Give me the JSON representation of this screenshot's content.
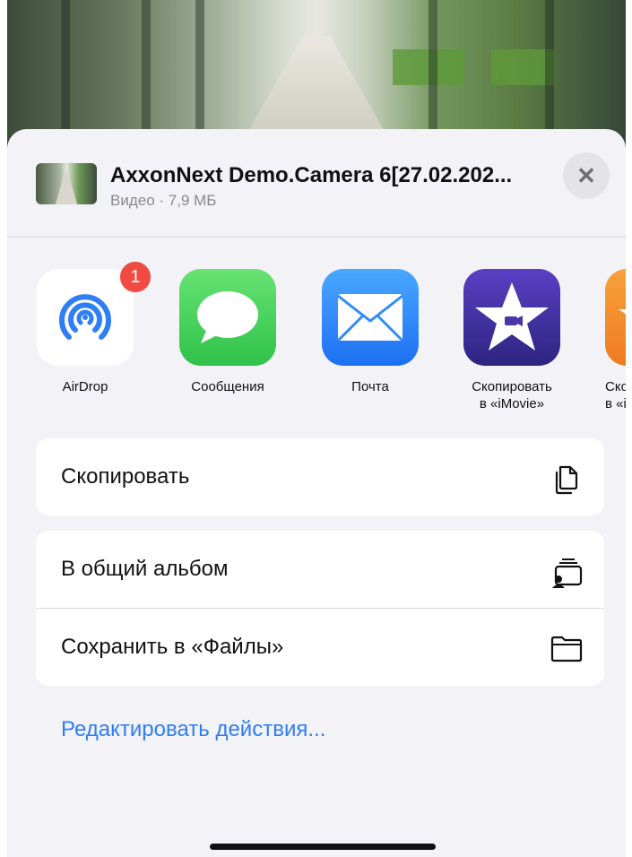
{
  "sheet": {
    "title": "AxxonNext Demo.Camera 6[27.02.202...",
    "subtitle": "Видео · 7,9 МБ"
  },
  "apps": [
    {
      "name": "AirDrop",
      "label1": "AirDrop",
      "label2": "",
      "badge": "1",
      "color": "#2f7ef6"
    },
    {
      "name": "messages",
      "label1": "Сообщения",
      "label2": "",
      "color": "#4cd964"
    },
    {
      "name": "mail",
      "label1": "Почта",
      "label2": "",
      "color": "#2f8cf6"
    },
    {
      "name": "imovie",
      "label1": "Скопировать",
      "label2": "в «iMovie»",
      "color": "#4a36a8"
    },
    {
      "name": "itunes",
      "label1": "Ско",
      "label2": "в «i",
      "color": "#f08a2a"
    }
  ],
  "actions": {
    "copy": "Скопировать",
    "shared_album": "В общий альбом",
    "save_files": "Сохранить в «Файлы»",
    "edit_actions": "Редактировать действия..."
  }
}
